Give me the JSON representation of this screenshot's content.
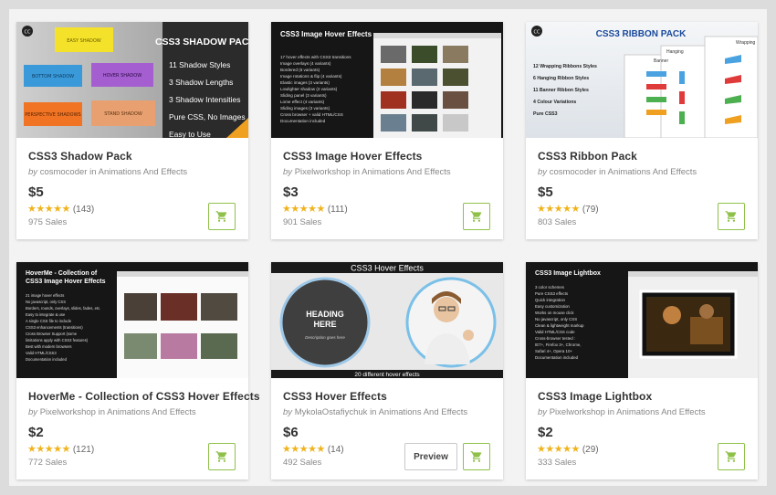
{
  "colors": {
    "accent": "#8fc14a",
    "star": "#f0b31c",
    "background": "#f3f3f3"
  },
  "products": [
    {
      "title": "CSS3 Shadow Pack",
      "by": "by",
      "author": "cosmocoder",
      "in": "in",
      "category": "Animations And Effects",
      "price": "$5",
      "rating_value": 4.5,
      "stars": "★★★★★",
      "reviews": "(143)",
      "sales": "975 Sales",
      "thumb": {
        "heading": "CSS3 SHADOW PACK",
        "bullets": [
          "11 Shadow Styles",
          "3 Shadow Lengths",
          "3 Shadow Intensities",
          "Pure CSS, No Images",
          "Easy to Use"
        ],
        "samples": [
          "EASY SHADOW",
          "BOTTOM SHADOW",
          "HOVER SHADOW",
          "PERSPECTIVE SHADOWS",
          "STAND SHADOW"
        ],
        "badge": "CC"
      }
    },
    {
      "title": "CSS3 Image Hover Effects",
      "by": "by",
      "author": "Pixelworkshop",
      "in": "in",
      "category": "Animations And Effects",
      "price": "$3",
      "rating_value": 4.5,
      "stars": "★★★★★",
      "reviews": "(111)",
      "sales": "901 Sales",
      "thumb": {
        "heading": "CSS3 Image Hover Effects",
        "bullets": [
          "17 hover effects with CSS3 transitions",
          "Image overlays (4 variants)",
          "Bordered (6 variants)",
          "Image rotations & flip (4 variants)",
          "Elastic images (3 variants)",
          "Lowlighter shadow (2 variants)",
          "Sliding panel (3 variants)",
          "Lome effect (4 variants)",
          "Sliding images (3 variants)",
          "Cross browser + valid HTML/CSS",
          "Documentation included"
        ]
      }
    },
    {
      "title": "CSS3 Ribbon Pack",
      "by": "by",
      "author": "cosmocoder",
      "in": "in",
      "category": "Animations And Effects",
      "price": "$5",
      "rating_value": 4.5,
      "stars": "★★★★★",
      "reviews": "(79)",
      "sales": "803 Sales",
      "thumb": {
        "heading": "CSS3 RIBBON PACK",
        "bullets": [
          "12 Wrapping Ribbons Styles",
          "6 Hanging Ribbon Styles",
          "11 Banner Ribbon Styles",
          "4 Colour Variations",
          "Pure CSS3"
        ],
        "panels": [
          "Hanging",
          "Wrapping",
          "Banner"
        ],
        "badge": "CC"
      }
    },
    {
      "title": "HoverMe - Collection of CSS3 Hover Effects",
      "by": "by",
      "author": "Pixelworkshop",
      "in": "in",
      "category": "Animations And Effects",
      "price": "$2",
      "rating_value": 4.5,
      "stars": "★★★★★",
      "reviews": "(121)",
      "sales": "772 Sales",
      "thumb": {
        "heading": "HoverMe - Collection of CSS3 Image Hover Effects",
        "bullets": [
          "21 image hover effects",
          "No javascript, only CSS",
          "Borders, rounds, overlays, slides, fades, etc.",
          "Easy to integrate & use",
          "A single CSS file to include",
          "CSS3 enhancements (transitions)",
          "Cross Browser Support (some",
          "limitations apply with CSS3 features)",
          "Best with modern browsers",
          "Valid HTML/CSS3",
          "Documentation included"
        ]
      }
    },
    {
      "title": "CSS3 Hover Effects",
      "by": "by",
      "author": "MykolaOstafiychuk",
      "in": "in",
      "category": "Animations And Effects",
      "price": "$6",
      "rating_value": 5,
      "stars": "★★★★★",
      "reviews": "(14)",
      "sales": "492 Sales",
      "preview_label": "Preview",
      "thumb": {
        "heading": "CSS3 Hover Effects",
        "circle_heading": "HEADING HERE",
        "circle_sub": "Description goes here",
        "footer": "20 different hover effects"
      }
    },
    {
      "title": "CSS3 Image Lightbox",
      "by": "by",
      "author": "Pixelworkshop",
      "in": "in",
      "category": "Animations And Effects",
      "price": "$2",
      "rating_value": 4.5,
      "stars": "★★★★★",
      "reviews": "(29)",
      "sales": "333 Sales",
      "thumb": {
        "heading": "CSS3 Image Lightbox",
        "bullets": [
          "3 color schemes",
          "Pure CSS3 effects",
          "Quick integration",
          "Easy customization",
          "Works on mouse click",
          "No javascript, only CSS",
          "Clean & lightweight markup",
          "Valid HTML/CSS code",
          "Cross-browser tested :",
          "IE7+, Firefox 3+, Chrome,",
          "Safari 4+, Opera 10+",
          "Documentation included"
        ]
      }
    }
  ]
}
